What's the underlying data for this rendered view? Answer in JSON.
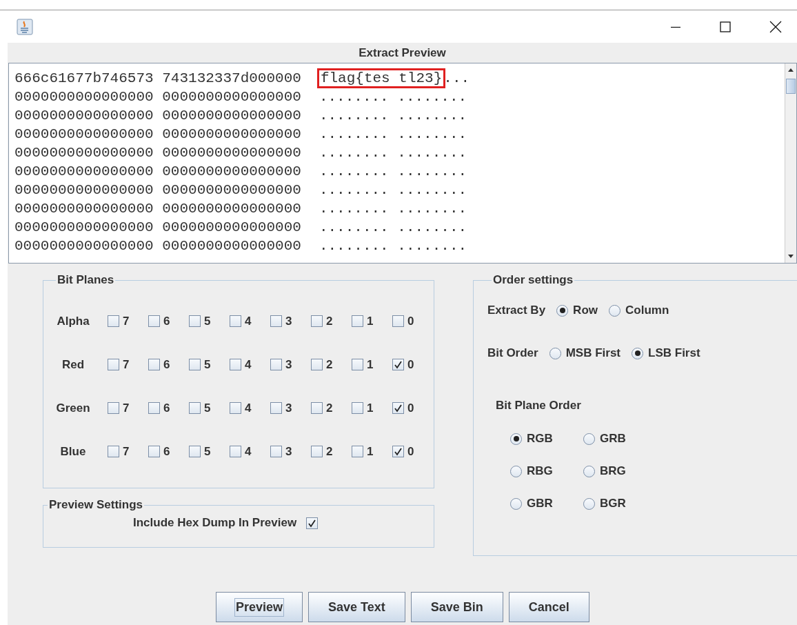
{
  "window": {
    "title": "Extract Preview"
  },
  "preview": {
    "rows": [
      {
        "hex": "666c61677b746573 743132337d000000",
        "ascii": "flag{tes tl23}",
        "ascii_rest": "...",
        "highlighted": true
      },
      {
        "hex": "0000000000000000 0000000000000000",
        "ascii": "........ ........",
        "highlighted": false
      },
      {
        "hex": "0000000000000000 0000000000000000",
        "ascii": "........ ........",
        "highlighted": false
      },
      {
        "hex": "0000000000000000 0000000000000000",
        "ascii": "........ ........",
        "highlighted": false
      },
      {
        "hex": "0000000000000000 0000000000000000",
        "ascii": "........ ........",
        "highlighted": false
      },
      {
        "hex": "0000000000000000 0000000000000000",
        "ascii": "........ ........",
        "highlighted": false
      },
      {
        "hex": "0000000000000000 0000000000000000",
        "ascii": "........ ........",
        "highlighted": false
      },
      {
        "hex": "0000000000000000 0000000000000000",
        "ascii": "........ ........",
        "highlighted": false
      },
      {
        "hex": "0000000000000000 0000000000000000",
        "ascii": "........ ........",
        "highlighted": false
      },
      {
        "hex": "0000000000000000 0000000000000000",
        "ascii": "........ ........",
        "highlighted": false
      }
    ]
  },
  "bit_planes": {
    "title": "Bit Planes",
    "channels": [
      {
        "name": "Alpha",
        "bits": [
          {
            "label": "7",
            "checked": false
          },
          {
            "label": "6",
            "checked": false
          },
          {
            "label": "5",
            "checked": false
          },
          {
            "label": "4",
            "checked": false
          },
          {
            "label": "3",
            "checked": false
          },
          {
            "label": "2",
            "checked": false
          },
          {
            "label": "1",
            "checked": false
          },
          {
            "label": "0",
            "checked": false
          }
        ]
      },
      {
        "name": "Red",
        "bits": [
          {
            "label": "7",
            "checked": false
          },
          {
            "label": "6",
            "checked": false
          },
          {
            "label": "5",
            "checked": false
          },
          {
            "label": "4",
            "checked": false
          },
          {
            "label": "3",
            "checked": false
          },
          {
            "label": "2",
            "checked": false
          },
          {
            "label": "1",
            "checked": false
          },
          {
            "label": "0",
            "checked": true
          }
        ]
      },
      {
        "name": "Green",
        "bits": [
          {
            "label": "7",
            "checked": false
          },
          {
            "label": "6",
            "checked": false
          },
          {
            "label": "5",
            "checked": false
          },
          {
            "label": "4",
            "checked": false
          },
          {
            "label": "3",
            "checked": false
          },
          {
            "label": "2",
            "checked": false
          },
          {
            "label": "1",
            "checked": false
          },
          {
            "label": "0",
            "checked": true
          }
        ]
      },
      {
        "name": "Blue",
        "bits": [
          {
            "label": "7",
            "checked": false
          },
          {
            "label": "6",
            "checked": false
          },
          {
            "label": "5",
            "checked": false
          },
          {
            "label": "4",
            "checked": false
          },
          {
            "label": "3",
            "checked": false
          },
          {
            "label": "2",
            "checked": false
          },
          {
            "label": "1",
            "checked": false
          },
          {
            "label": "0",
            "checked": true
          }
        ]
      }
    ]
  },
  "preview_settings": {
    "title": "Preview Settings",
    "label": "Include Hex Dump In Preview",
    "checked": true
  },
  "order_settings": {
    "title": "Order settings",
    "extract_by": {
      "label": "Extract By",
      "options": [
        {
          "label": "Row",
          "selected": true
        },
        {
          "label": "Column",
          "selected": false
        }
      ]
    },
    "bit_order": {
      "label": "Bit Order",
      "options": [
        {
          "label": "MSB First",
          "selected": false
        },
        {
          "label": "LSB First",
          "selected": true
        }
      ]
    },
    "bit_plane_order": {
      "label": "Bit Plane Order",
      "options": [
        {
          "label": "RGB",
          "selected": true
        },
        {
          "label": "GRB",
          "selected": false
        },
        {
          "label": "RBG",
          "selected": false
        },
        {
          "label": "BRG",
          "selected": false
        },
        {
          "label": "GBR",
          "selected": false
        },
        {
          "label": "BGR",
          "selected": false
        }
      ]
    }
  },
  "buttons": [
    {
      "label": "Preview",
      "focused": true
    },
    {
      "label": "Save Text",
      "focused": false
    },
    {
      "label": "Save Bin",
      "focused": false
    },
    {
      "label": "Cancel",
      "focused": false
    }
  ]
}
